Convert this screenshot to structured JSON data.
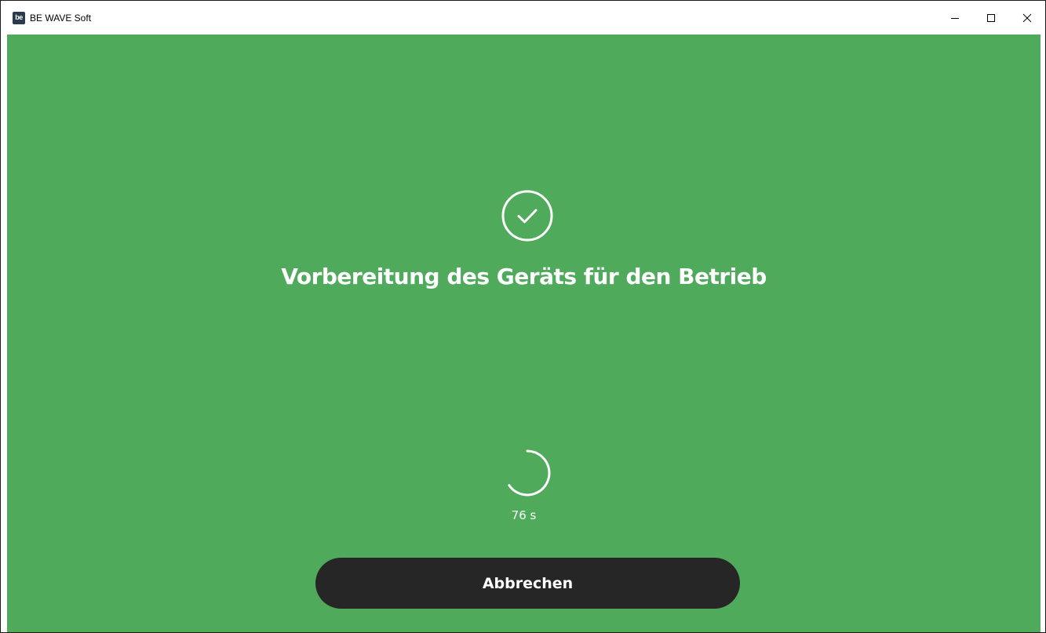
{
  "window": {
    "title": "BE WAVE Soft",
    "logo_text": "be",
    "controls": {
      "minimize_icon": "minimize-icon",
      "maximize_icon": "maximize-icon",
      "close_icon": "close-icon"
    }
  },
  "status": {
    "icon": "check-circle-icon",
    "heading": "Vorbereitung des Geräts für den Betrieb",
    "spinner_icon": "loading-spinner-icon",
    "countdown": "76 s"
  },
  "actions": {
    "cancel_label": "Abbrechen"
  },
  "colors": {
    "background": "#4fab5b",
    "button": "#262626",
    "text": "#ffffff"
  }
}
